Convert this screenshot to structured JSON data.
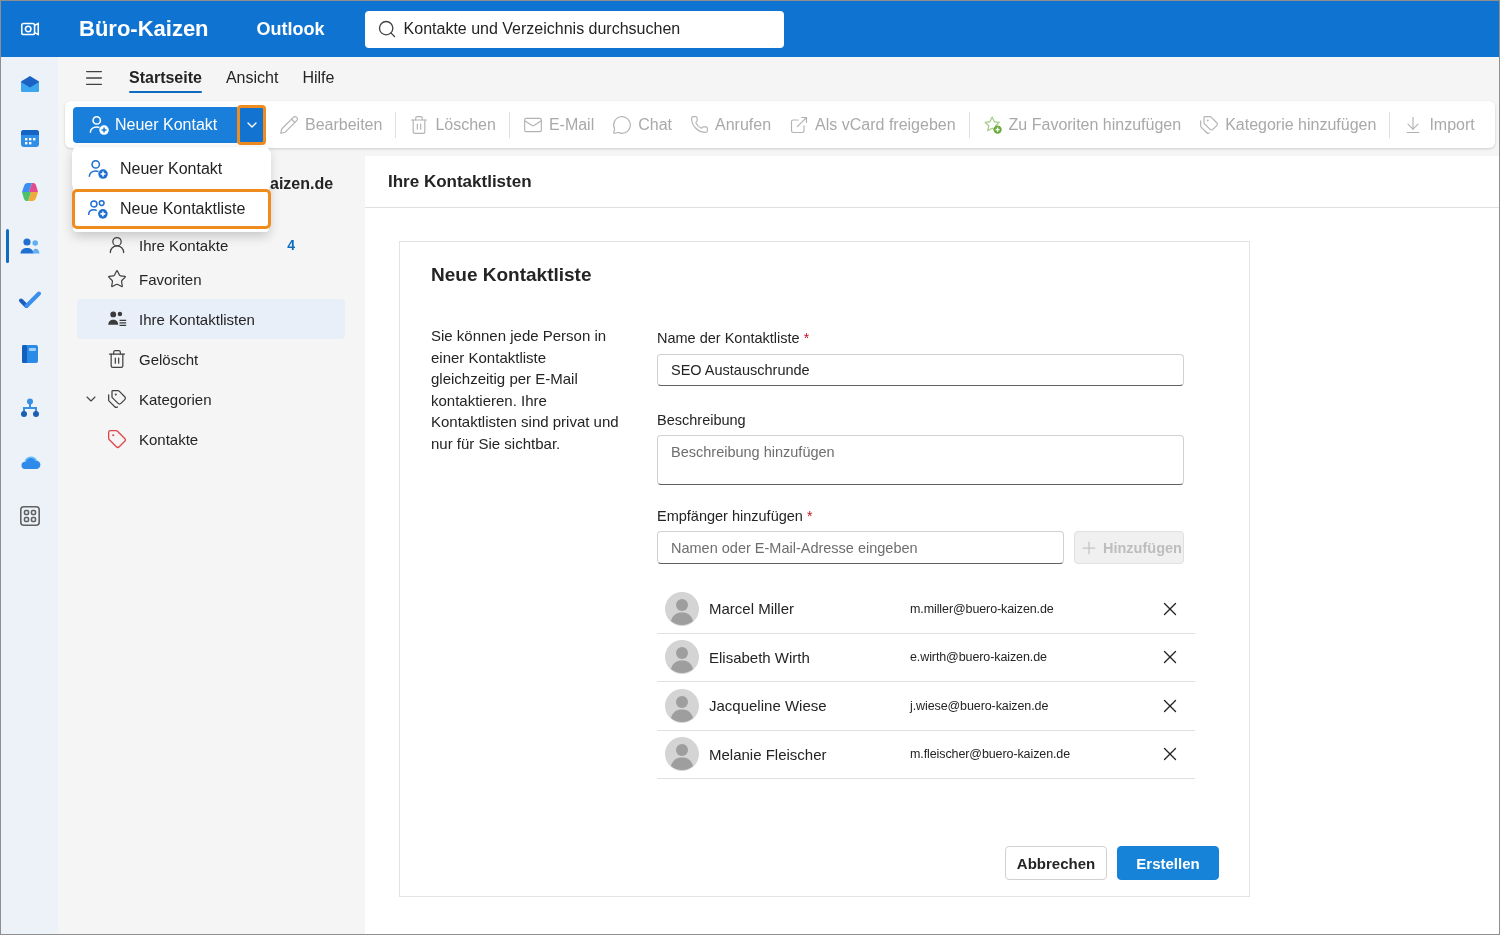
{
  "header": {
    "brand": "Büro-Kaizen",
    "app": "Outlook",
    "search": {
      "placeholder": "Kontakte und Verzeichnis durchsuchen"
    }
  },
  "rail": {
    "items": [
      {
        "selected": false
      },
      {
        "selected": false
      },
      {
        "selected": false
      },
      {
        "selected": true
      },
      {
        "selected": false
      },
      {
        "selected": false
      },
      {
        "selected": false
      },
      {
        "selected": false
      },
      {
        "selected": false
      }
    ]
  },
  "tabs": [
    {
      "label": "Startseite",
      "selected": true
    },
    {
      "label": "Ansicht",
      "selected": false
    },
    {
      "label": "Hilfe",
      "selected": false
    }
  ],
  "toolbar": {
    "primary": {
      "label": "Neuer Kontakt",
      "menu_highlighted": true
    },
    "groups": [
      {
        "items": [
          {
            "label": "Bearbeiten",
            "disabled": true
          }
        ]
      },
      {
        "items": [
          {
            "label": "Löschen",
            "disabled": true
          }
        ]
      },
      {
        "items": [
          {
            "label": "E-Mail",
            "disabled": true
          },
          {
            "label": "Chat",
            "disabled": true
          },
          {
            "label": "Anrufen",
            "disabled": true
          },
          {
            "label": "Als vCard freigeben",
            "disabled": true
          }
        ]
      },
      {
        "items": [
          {
            "label": "Zu Favoriten hinzufügen",
            "disabled": true
          },
          {
            "label": "Kategorie hinzufügen",
            "disabled": true
          }
        ]
      },
      {
        "items": [
          {
            "label": "Import",
            "disabled": true
          }
        ]
      }
    ]
  },
  "dropdown_menu": {
    "items": [
      {
        "label": "Neuer Kontakt",
        "highlighted": false
      },
      {
        "label": "Neue Kontaktliste",
        "highlighted": true
      }
    ]
  },
  "sidebar": {
    "account": "aizen.de",
    "items": [
      {
        "label": "Ihre Kontakte",
        "count": "4",
        "selected": false
      },
      {
        "label": "Favoriten",
        "selected": false
      },
      {
        "label": "Ihre Kontaktlisten",
        "selected": true
      },
      {
        "label": "Gelöscht",
        "selected": false
      },
      {
        "label": "Kategorien",
        "selected": false,
        "expanded": true,
        "children": [
          {
            "label": "Kontakte",
            "selected": false,
            "color": "#e0474c"
          }
        ]
      }
    ]
  },
  "main": {
    "title": "Ihre Kontaktlisten"
  },
  "form": {
    "title": "Neue Kontaktliste",
    "description": "Sie können jede Person in einer Kontaktliste gleichzeitig per E-Mail kontaktieren. Ihre Kontaktlisten sind privat und nur für Sie sichtbar.",
    "fields": [
      {
        "kind": "input",
        "label": "Name der Kontaktliste",
        "required_mark": "*",
        "value": "SEO Austauschrunde"
      },
      {
        "kind": "textarea",
        "label": "Beschreibung",
        "placeholder": "Beschreibung hinzufügen"
      },
      {
        "kind": "add",
        "label": "Empfänger hinzufügen",
        "required_mark": "*",
        "placeholder": "Namen oder E-Mail-Adresse eingeben",
        "button": {
          "label": "Hinzufügen",
          "disabled": true
        }
      }
    ],
    "recipients": [
      {
        "name": "Marcel Miller",
        "email": "m.miller@buero-kaizen.de"
      },
      {
        "name": "Elisabeth Wirth",
        "email": "e.wirth@buero-kaizen.de"
      },
      {
        "name": "Jacqueline Wiese",
        "email": "j.wiese@buero-kaizen.de"
      },
      {
        "name": "Melanie Fleischer",
        "email": "m.fleischer@buero-kaizen.de"
      }
    ],
    "buttons": [
      {
        "label": "Abbrechen",
        "kind": "secondary"
      },
      {
        "label": "Erstellen",
        "kind": "primary"
      }
    ]
  }
}
